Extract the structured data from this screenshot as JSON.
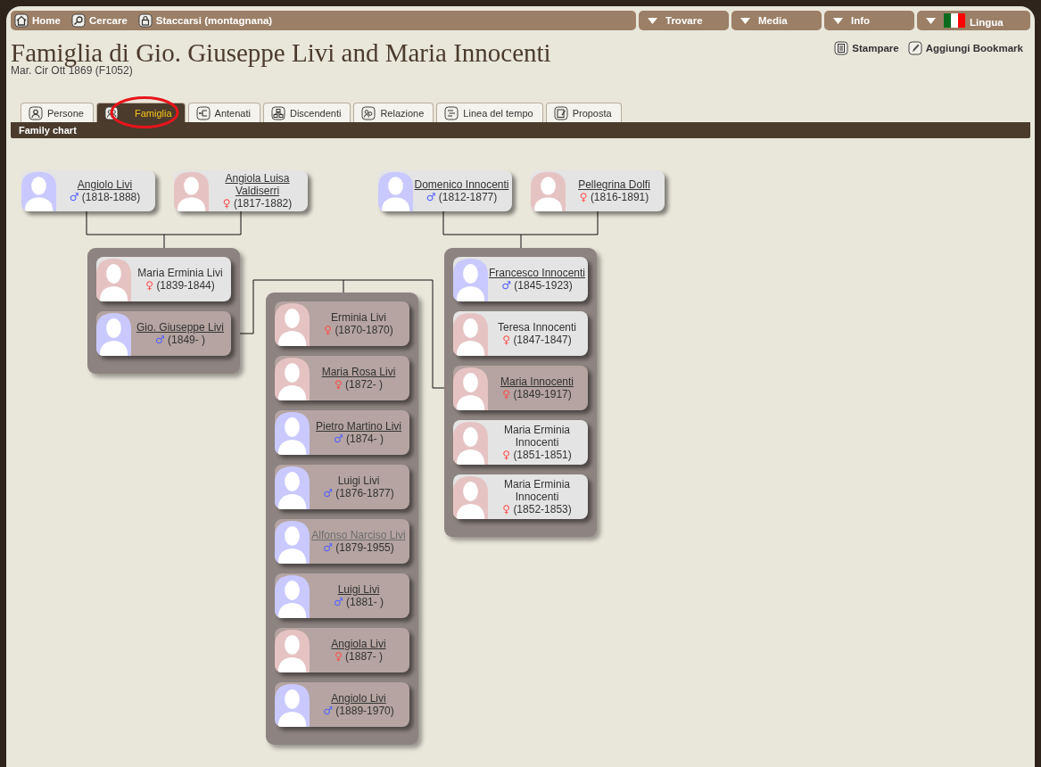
{
  "nav": {
    "links": [
      {
        "label": "Home"
      },
      {
        "label": "Cercare"
      },
      {
        "label": "Staccarsi (montagnana)"
      }
    ],
    "menus": [
      {
        "label": "Trovare",
        "kind": "plain"
      },
      {
        "label": "Media",
        "kind": "plain"
      },
      {
        "label": "Info",
        "kind": "plain"
      },
      {
        "label": "Lingua",
        "kind": "flag"
      }
    ]
  },
  "title": "Famiglia di Gio. Giuseppe Livi and Maria Innocenti",
  "subtitle": "Mar. Cir Ott 1869 (F1052)",
  "actions": [
    {
      "label": "Stampare"
    },
    {
      "label": "Aggiungi Bookmark"
    }
  ],
  "tabs": [
    {
      "label": "Persone",
      "selected": false,
      "circled": false
    },
    {
      "label": "Famiglia",
      "selected": true,
      "circled": true
    },
    {
      "label": "Antenati",
      "selected": false,
      "circled": false
    },
    {
      "label": "Discendenti",
      "selected": false,
      "circled": false
    },
    {
      "label": "Relazione",
      "selected": false,
      "circled": false
    },
    {
      "label": "Linea del tempo",
      "selected": false,
      "circled": false
    },
    {
      "label": "Proposta",
      "selected": false,
      "circled": false
    }
  ],
  "section_bar": "Family chart",
  "chart": {
    "paternal_grandparents": [
      {
        "name": "Angiolo Livi",
        "kind": "male",
        "symbol": "♂",
        "dates": "(1818-1888)",
        "linked": true,
        "visited": false,
        "in_family": false
      },
      {
        "name": "Angiola Luisa Valdiserri",
        "kind": "female",
        "symbol": "♀",
        "dates": "(1817-1882)",
        "linked": true,
        "visited": false,
        "in_family": false
      }
    ],
    "maternal_grandparents": [
      {
        "name": "Domenico Innocenti",
        "kind": "male",
        "symbol": "♂",
        "dates": "(1812-1877)",
        "linked": true,
        "visited": false,
        "in_family": false
      },
      {
        "name": "Pellegrina Dolfi",
        "kind": "female",
        "symbol": "♀",
        "dates": "(1816-1891)",
        "linked": true,
        "visited": false,
        "in_family": false
      }
    ],
    "husband_siblings": [
      {
        "name": "Maria Erminia Livi",
        "kind": "female",
        "symbol": "♀",
        "dates": "(1839-1844)",
        "linked": false,
        "visited": false,
        "in_family": false
      },
      {
        "name": "Gio. Giuseppe Livi",
        "kind": "male",
        "symbol": "♂",
        "dates": "(1849- )",
        "linked": true,
        "visited": false,
        "in_family": true
      }
    ],
    "children": [
      {
        "name": "Erminia Livi",
        "kind": "female",
        "symbol": "♀",
        "dates": "(1870-1870)",
        "linked": false,
        "visited": false,
        "in_family": true
      },
      {
        "name": "Maria Rosa Livi",
        "kind": "female",
        "symbol": "♀",
        "dates": "(1872- )",
        "linked": true,
        "visited": false,
        "in_family": true
      },
      {
        "name": "Pietro Martino Livi",
        "kind": "male",
        "symbol": "♂",
        "dates": "(1874- )",
        "linked": true,
        "visited": false,
        "in_family": true
      },
      {
        "name": "Luigi Livi",
        "kind": "male",
        "symbol": "♂",
        "dates": "(1876-1877)",
        "linked": false,
        "visited": false,
        "in_family": true
      },
      {
        "name": "Alfonso Narciso Livi",
        "kind": "male",
        "symbol": "♂",
        "dates": "(1879-1955)",
        "linked": true,
        "visited": true,
        "in_family": true
      },
      {
        "name": "Luigi Livi",
        "kind": "male",
        "symbol": "♂",
        "dates": "(1881- )",
        "linked": true,
        "visited": false,
        "in_family": true
      },
      {
        "name": "Angiola Livi",
        "kind": "female",
        "symbol": "♀",
        "dates": "(1887- )",
        "linked": true,
        "visited": false,
        "in_family": true
      },
      {
        "name": "Angiolo Livi",
        "kind": "male",
        "symbol": "♂",
        "dates": "(1889-1970)",
        "linked": true,
        "visited": false,
        "in_family": true
      }
    ],
    "wife_siblings": [
      {
        "name": "Francesco Innocenti",
        "kind": "male",
        "symbol": "♂",
        "dates": "(1845-1923)",
        "linked": true,
        "visited": false,
        "in_family": false
      },
      {
        "name": "Teresa Innocenti",
        "kind": "female",
        "symbol": "♀",
        "dates": "(1847-1847)",
        "linked": false,
        "visited": false,
        "in_family": false
      },
      {
        "name": "Maria Innocenti",
        "kind": "female",
        "symbol": "♀",
        "dates": "(1849-1917)",
        "linked": true,
        "visited": false,
        "in_family": true
      },
      {
        "name": "Maria Erminia Innocenti",
        "kind": "female",
        "symbol": "♀",
        "dates": "(1851-1851)",
        "linked": false,
        "visited": false,
        "in_family": false
      },
      {
        "name": "Maria Erminia Innocenti",
        "kind": "female",
        "symbol": "♀",
        "dates": "(1852-1853)",
        "linked": false,
        "visited": false,
        "in_family": false
      }
    ]
  }
}
